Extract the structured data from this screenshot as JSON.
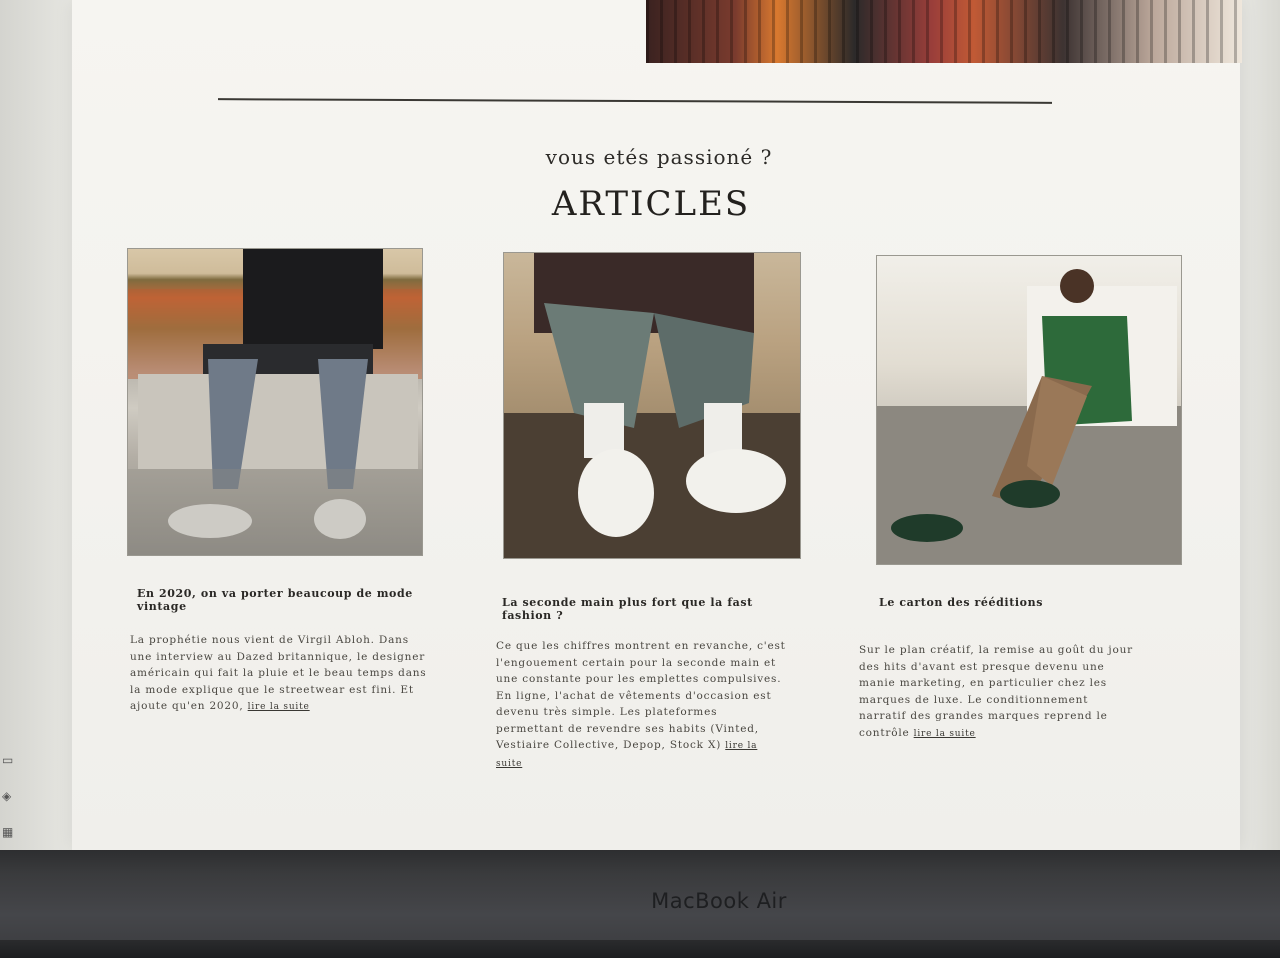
{
  "section": {
    "kicker": "vous etés passioné ?",
    "title": "ARTICLES"
  },
  "articles": [
    {
      "title": "En 2020, on va porter beaucoup de mode vintage",
      "text": "La prophétie nous vient de Virgil Abloh. Dans une interview au Dazed britannique, le designer américain qui fait la pluie et le beau temps dans la mode explique que le streetwear est fini. Et ajoute qu'en 2020, ",
      "read_more": "lire la suite"
    },
    {
      "title": "La seconde main plus fort que la fast fashion ?",
      "text": "Ce que les chiffres montrent en revanche, c'est l'engouement certain pour la seconde main et une constante pour les emplettes compulsives. En ligne, l'achat de vêtements d'occasion est devenu très simple. Les plateformes permettant de revendre ses habits (Vinted, Vestiaire Collective, Depop, Stock X) ",
      "read_more": "lire la suite"
    },
    {
      "title": "Le carton des rééditions",
      "text": "Sur le plan créatif, la remise au goût du jour des hits d'avant est presque devenu une manie marketing, en particulier chez les marques de luxe. Le conditionnement narratif des grandes marques reprend le contrôle ",
      "read_more": "lire la suite"
    }
  ],
  "device": {
    "brand": "MacBook Air"
  }
}
